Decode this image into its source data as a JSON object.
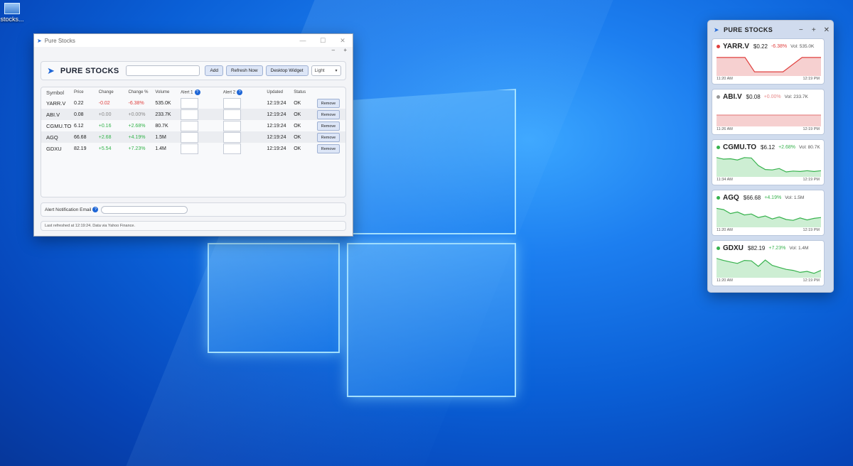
{
  "desktop": {
    "icon_label": "stocks..."
  },
  "main_window": {
    "title": "Pure Stocks",
    "controls": {
      "minimize": "—",
      "maximize": "☐",
      "close": "✕"
    },
    "sub_controls": [
      "–",
      "+"
    ],
    "brand": "PURE STOCKS",
    "symbol_input_value": "",
    "buttons": {
      "add": "Add",
      "refresh": "Refresh Now",
      "widget": "Desktop Widget"
    },
    "theme_select": "Light",
    "columns": [
      "Symbol",
      "Price",
      "Change",
      "Change %",
      "Volume",
      "Alert 1",
      "Alert 2",
      "Updated",
      "Status"
    ],
    "help_glyph": "?",
    "rows": [
      {
        "symbol": "YARR.V",
        "price": "0.22",
        "change": "-0.02",
        "change_pct": "-6.38%",
        "volume": "535.0K",
        "updated": "12:19:24",
        "status": "OK",
        "remove": "Remove",
        "dir": "neg"
      },
      {
        "symbol": "ABI.V",
        "price": "0.08",
        "change": "+0.00",
        "change_pct": "+0.00%",
        "volume": "233.7K",
        "updated": "12:19:24",
        "status": "OK",
        "remove": "Remove",
        "dir": "zero"
      },
      {
        "symbol": "CGMU.TO",
        "price": "6.12",
        "change": "+0.16",
        "change_pct": "+2.68%",
        "volume": "80.7K",
        "updated": "12:19:24",
        "status": "OK",
        "remove": "Remove",
        "dir": "pos"
      },
      {
        "symbol": "AGQ",
        "price": "66.68",
        "change": "+2.68",
        "change_pct": "+4.19%",
        "volume": "1.5M",
        "updated": "12:19:24",
        "status": "OK",
        "remove": "Remove",
        "dir": "pos"
      },
      {
        "symbol": "GDXU",
        "price": "82.19",
        "change": "+5.54",
        "change_pct": "+7.23%",
        "volume": "1.4M",
        "updated": "12:19:24",
        "status": "OK",
        "remove": "Remove",
        "dir": "pos"
      }
    ],
    "email_label": "Alert Notification Email",
    "email_value": "",
    "status_text": "Last refreshed at 12:19:24. Data via Yahoo Finance."
  },
  "widget": {
    "title": "PURE STOCKS",
    "controls": [
      "−",
      "+",
      "✕"
    ],
    "cards": [
      {
        "symbol": "YARR.V",
        "price": "$0.22",
        "change": "-6.38%",
        "volume": "Vol: 535.0K",
        "start": "11:20 AM",
        "end": "12:19 PM",
        "color": "#e0413f",
        "fill": "#f6d0d0",
        "dot": "#e0413f",
        "series": [
          0.86,
          0.86,
          0.86,
          0.86,
          0.14,
          0.14,
          0.14,
          0.14,
          0.5,
          0.86,
          0.86,
          0.86
        ]
      },
      {
        "symbol": "ABI.V",
        "price": "$0.08",
        "change": "+0.00%",
        "volume": "Vol: 233.7K",
        "start": "11:26 AM",
        "end": "12:19 PM",
        "color": "#e88a8a",
        "fill": "#f6d0d0",
        "dot": "#999999",
        "series": [
          0.5,
          0.5,
          0.5,
          0.5,
          0.5,
          0.5,
          0.5,
          0.5,
          0.5,
          0.5,
          0.5,
          0.5
        ]
      },
      {
        "symbol": "CGMU.TO",
        "price": "$6.12",
        "change": "+2.68%",
        "volume": "Vol: 80.7K",
        "start": "11:34 AM",
        "end": "12:19 PM",
        "color": "#37b24d",
        "fill": "#cdeed3",
        "dot": "#37b24d",
        "series": [
          0.9,
          0.82,
          0.84,
          0.78,
          0.9,
          0.88,
          0.5,
          0.3,
          0.28,
          0.35,
          0.18,
          0.22,
          0.2,
          0.24,
          0.2,
          0.24
        ]
      },
      {
        "symbol": "AGQ",
        "price": "$66.68",
        "change": "+4.19%",
        "volume": "Vol: 1.5M",
        "start": "11:20 AM",
        "end": "12:19 PM",
        "color": "#37b24d",
        "fill": "#cdeed3",
        "dot": "#37b24d",
        "series": [
          0.88,
          0.82,
          0.62,
          0.7,
          0.55,
          0.6,
          0.42,
          0.5,
          0.35,
          0.45,
          0.32,
          0.28,
          0.4,
          0.3,
          0.38,
          0.42
        ]
      },
      {
        "symbol": "GDXU",
        "price": "$82.19",
        "change": "+7.23%",
        "volume": "Vol: 1.4M",
        "start": "11:20 AM",
        "end": "12:19 PM",
        "color": "#37b24d",
        "fill": "#cdeed3",
        "dot": "#37b24d",
        "series": [
          0.9,
          0.8,
          0.72,
          0.65,
          0.8,
          0.78,
          0.5,
          0.82,
          0.55,
          0.45,
          0.35,
          0.3,
          0.2,
          0.25,
          0.15,
          0.3
        ]
      }
    ]
  }
}
